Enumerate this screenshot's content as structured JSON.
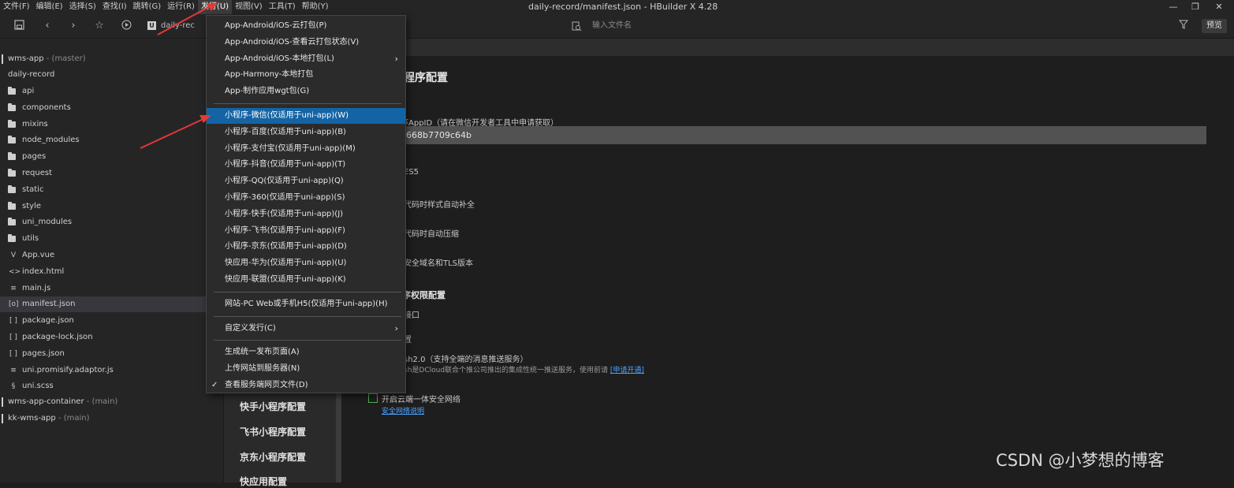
{
  "menubar": {
    "items": [
      "文件(F)",
      "编辑(E)",
      "选择(S)",
      "查找(I)",
      "跳转(G)",
      "运行(R)",
      "发行(U)",
      "视图(V)",
      "工具(T)",
      "帮助(Y)"
    ],
    "active": "发行(U)"
  },
  "window": {
    "title": "daily-record/manifest.json - HBuilder X 4.28"
  },
  "toolbar": {
    "path": "daily-rec",
    "search_placeholder": "输入文件名",
    "preview_label": "预览"
  },
  "sidebar": {
    "projects": [
      {
        "name": "wms-app",
        "branch": "- (master)"
      },
      {
        "name": "daily-record",
        "branch": ""
      }
    ],
    "tree": [
      {
        "name": "api",
        "type": "folder"
      },
      {
        "name": "components",
        "type": "folder"
      },
      {
        "name": "mixins",
        "type": "folder"
      },
      {
        "name": "node_modules",
        "type": "folder"
      },
      {
        "name": "pages",
        "type": "folder"
      },
      {
        "name": "request",
        "type": "folder"
      },
      {
        "name": "static",
        "type": "folder"
      },
      {
        "name": "style",
        "type": "folder"
      },
      {
        "name": "uni_modules",
        "type": "folder"
      },
      {
        "name": "utils",
        "type": "folder"
      },
      {
        "name": "App.vue",
        "type": "vue",
        "glyph": "V"
      },
      {
        "name": "index.html",
        "type": "html",
        "glyph": "<>"
      },
      {
        "name": "main.js",
        "type": "js",
        "glyph": "≡"
      },
      {
        "name": "manifest.json",
        "type": "json",
        "glyph": "[o]",
        "selected": true
      },
      {
        "name": "package.json",
        "type": "json",
        "glyph": "[ ]"
      },
      {
        "name": "package-lock.json",
        "type": "json",
        "glyph": "[ ]"
      },
      {
        "name": "pages.json",
        "type": "json",
        "glyph": "[ ]"
      },
      {
        "name": "uni.promisify.adaptor.js",
        "type": "js",
        "glyph": "≡"
      },
      {
        "name": "uni.scss",
        "type": "scss",
        "glyph": "§"
      }
    ],
    "other_projects": [
      {
        "name": "wms-app-container",
        "branch": "- (main)"
      },
      {
        "name": "kk-wms-app",
        "branch": "- (main)"
      }
    ]
  },
  "nav_panel": {
    "items": [
      "快手小程序配置",
      "飞书小程序配置",
      "京东小程序配置",
      "快应用配置"
    ]
  },
  "editor": {
    "section_title": "程序配置",
    "appid_label": "序AppID（请在微信开发者工具中申请获取）",
    "appid_value": "3668b7709c64b",
    "es5": "ES5",
    "style_autoprefix": "代码时样式自动补全",
    "minify": "代码时自动压缩",
    "domain_tls": "安全域名和TLS版本",
    "permission_title": "序权限配置",
    "location_item": "接口",
    "misc_item": "置",
    "push_title": "sh2.0（支持全端的消息推送服务）",
    "push_desc": "sh是DCloud联合个推公司推出的集成性统一推送服务，使用前请",
    "push_link": "[申请开通]",
    "secure_network_label": "开启云端一体安全网络",
    "secure_network_link": "安全网络说明"
  },
  "dropdown": {
    "groups": [
      [
        {
          "label": "App-Android/iOS-云打包(P)"
        },
        {
          "label": "App-Android/iOS-查看云打包状态(V)"
        },
        {
          "label": "App-Android/iOS-本地打包(L)",
          "submenu": true
        },
        {
          "label": "App-Harmony-本地打包"
        },
        {
          "label": "App-制作应用wgt包(G)"
        }
      ],
      [
        {
          "label": "小程序-微信(仅适用于uni-app)(W)",
          "highlight": true
        },
        {
          "label": "小程序-百度(仅适用于uni-app)(B)"
        },
        {
          "label": "小程序-支付宝(仅适用于uni-app)(M)"
        },
        {
          "label": "小程序-抖音(仅适用于uni-app)(T)"
        },
        {
          "label": "小程序-QQ(仅适用于uni-app)(Q)"
        },
        {
          "label": "小程序-360(仅适用于uni-app)(S)"
        },
        {
          "label": "小程序-快手(仅适用于uni-app)(J)"
        },
        {
          "label": "小程序-飞书(仅适用于uni-app)(F)"
        },
        {
          "label": "小程序-京东(仅适用于uni-app)(D)"
        },
        {
          "label": "快应用-华为(仅适用于uni-app)(U)"
        },
        {
          "label": "快应用-联盟(仅适用于uni-app)(K)"
        }
      ],
      [
        {
          "label": "网站-PC Web或手机H5(仅适用于uni-app)(H)"
        }
      ],
      [
        {
          "label": "自定义发行(C)",
          "submenu": true
        }
      ],
      [
        {
          "label": "生成统一发布页面(A)"
        },
        {
          "label": "上传网站到服务器(N)"
        },
        {
          "label": "查看服务端网页文件(D)",
          "checked": true
        }
      ]
    ]
  },
  "watermark": "CSDN @小梦想的博客",
  "colors": {
    "accent": "#1464a5",
    "annotation_arrow": "#e53935",
    "background": "#1e1e1e",
    "sidebar": "#252526"
  }
}
